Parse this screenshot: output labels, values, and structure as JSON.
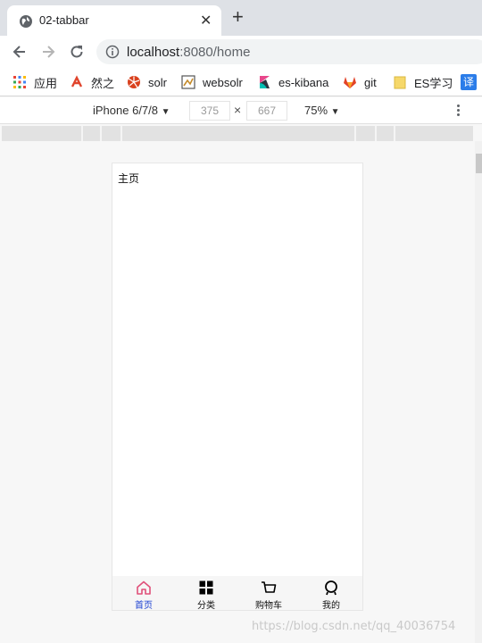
{
  "browser": {
    "tab_title": "02-tabbar",
    "tab_close": "✕",
    "new_tab": "+",
    "url_host": "localhost",
    "url_rest": ":8080/home"
  },
  "bookmarks": [
    {
      "label": "应用",
      "icon": "apps-grid-icon"
    },
    {
      "label": "然之",
      "icon": "ranzhi-icon"
    },
    {
      "label": "solr",
      "icon": "solr-icon"
    },
    {
      "label": "websolr",
      "icon": "websolr-icon"
    },
    {
      "label": "es-kibana",
      "icon": "kibana-icon"
    },
    {
      "label": "git",
      "icon": "gitlab-icon"
    },
    {
      "label": "ES学习",
      "icon": "folder-icon"
    },
    {
      "label": "",
      "icon": "translate-icon",
      "glyph": "译"
    }
  ],
  "devtools": {
    "device": "iPhone 6/7/8",
    "width": "375",
    "times": "×",
    "height": "667",
    "zoom": "75%",
    "caret": "▼"
  },
  "app": {
    "page_title": "主页",
    "tabs": [
      {
        "label": "首页",
        "icon": "home-icon",
        "active": true
      },
      {
        "label": "分类",
        "icon": "grid-icon",
        "active": false
      },
      {
        "label": "购物车",
        "icon": "cart-icon",
        "active": false
      },
      {
        "label": "我的",
        "icon": "profile-icon",
        "active": false
      }
    ],
    "active_color": "#1a3fd1",
    "home_icon_color": "#e0507a"
  },
  "watermark": "https://blog.csdn.net/qq_40036754"
}
